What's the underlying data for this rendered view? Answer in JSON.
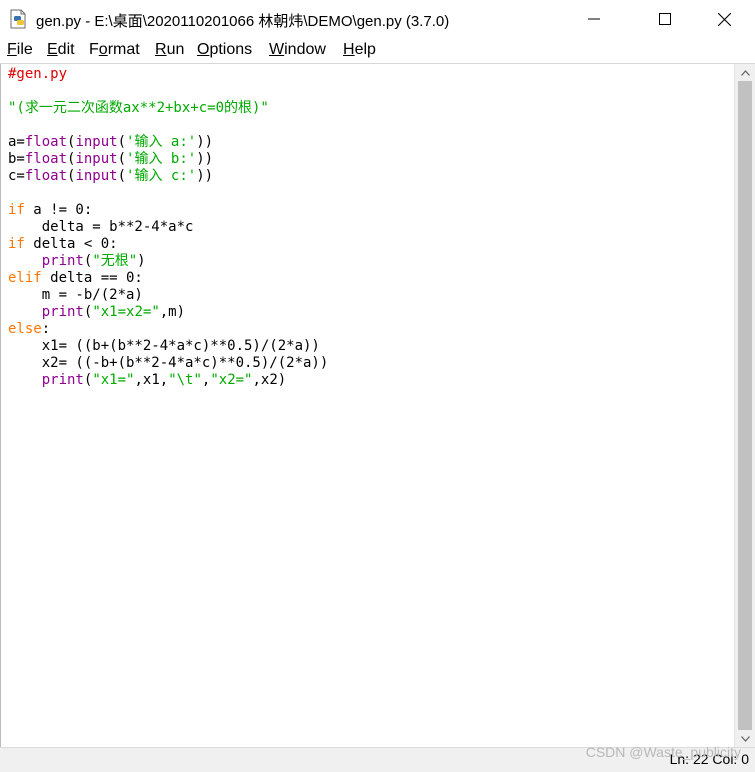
{
  "window": {
    "title": "gen.py - E:\\桌面\\2020110201066 林朝炜\\DEMO\\gen.py (3.7.0)"
  },
  "menu": [
    {
      "underline": "F",
      "rest": "ile"
    },
    {
      "underline": "E",
      "rest": "dit"
    },
    {
      "pre": "F",
      "underline": "o",
      "rest": "rmat"
    },
    {
      "underline": "R",
      "rest": "un"
    },
    {
      "underline": "O",
      "rest": "ptions"
    },
    {
      "underline": "W",
      "rest": "indow"
    },
    {
      "underline": "H",
      "rest": "elp"
    }
  ],
  "code": {
    "l1": "#gen.py",
    "l3": "\"(求一元二次函数ax**2+bx+c=0的根)\"",
    "l5": {
      "a": "a=",
      "b": "float",
      "c": "(",
      "d": "input",
      "e": "(",
      "f": "'输入 a:'",
      "g": "))"
    },
    "l6": {
      "a": "b=",
      "b": "float",
      "c": "(",
      "d": "input",
      "e": "(",
      "f": "'输入 b:'",
      "g": "))"
    },
    "l7": {
      "a": "c=",
      "b": "float",
      "c": "(",
      "d": "input",
      "e": "(",
      "f": "'输入 c:'",
      "g": "))"
    },
    "l9": {
      "kw": "if",
      "rest": " a != 0:"
    },
    "l10": "    delta = b**2-4*a*c",
    "l11": {
      "kw": "if",
      "rest": " delta < 0:"
    },
    "l12": {
      "ind": "    ",
      "bi": "print",
      "p1": "(",
      "s": "\"无根\"",
      "p2": ")"
    },
    "l13": {
      "kw": "elif",
      "rest": " delta == 0:"
    },
    "l14": "    m = -b/(2*a)",
    "l15": {
      "ind": "    ",
      "bi": "print",
      "p1": "(",
      "s": "\"x1=x2=\"",
      "p2": ",m)"
    },
    "l16": {
      "kw": "else",
      "rest": ":"
    },
    "l17": "    x1= ((b+(b**2-4*a*c)**0.5)/(2*a))",
    "l18": "    x2= ((-b+(b**2-4*a*c)**0.5)/(2*a))",
    "l19": {
      "ind": "    ",
      "bi": "print",
      "p1": "(",
      "s1": "\"x1=\"",
      "m1": ",x1,",
      "s2": "\"\\t\"",
      "m2": ",",
      "s3": "\"x2=\"",
      "m3": ",x2)"
    }
  },
  "status": "Ln: 22   Col: 0",
  "watermark": "CSDN @Waste_publicity",
  "colors": {
    "comment": "#dd0000",
    "string": "#00aa00",
    "keyword": "#ff7700",
    "builtin": "#900090"
  },
  "icons": [
    "python-file-icon",
    "minimize-icon",
    "maximize-icon",
    "close-icon",
    "scroll-up-arrow-icon",
    "scroll-down-arrow-icon"
  ]
}
